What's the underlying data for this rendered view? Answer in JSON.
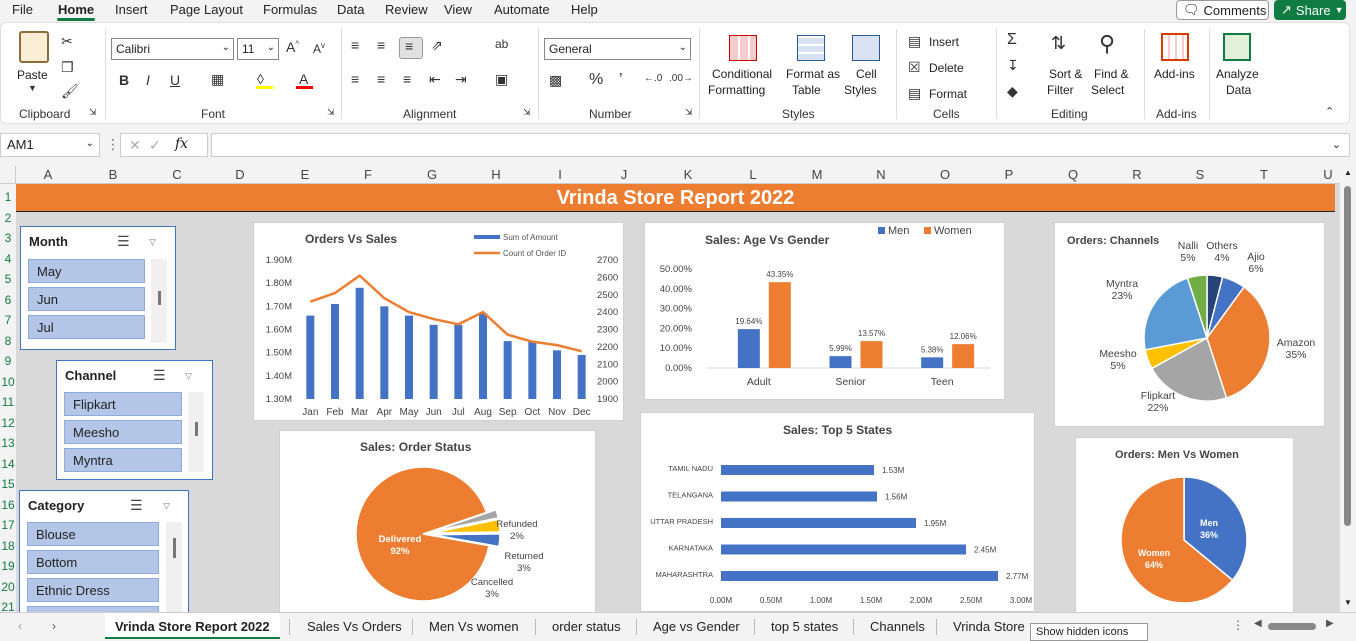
{
  "menu": {
    "items": [
      "File",
      "Home",
      "Insert",
      "Page Layout",
      "Formulas",
      "Data",
      "Review",
      "View",
      "Automate",
      "Help"
    ],
    "comments_label": "Comments",
    "share_label": "Share"
  },
  "ribbon": {
    "clipboard": {
      "label": "Clipboard",
      "paste": "Paste"
    },
    "font": {
      "label": "Font",
      "family": "Calibri",
      "size": "11"
    },
    "alignment": {
      "label": "Alignment"
    },
    "number": {
      "label": "Number",
      "format": "General"
    },
    "styles": {
      "label": "Styles",
      "conditional_1": "Conditional",
      "conditional_2": "Formatting",
      "format_table_1": "Format as",
      "format_table_2": "Table",
      "cell_styles_1": "Cell",
      "cell_styles_2": "Styles"
    },
    "cells": {
      "label": "Cells",
      "insert": "Insert",
      "delete": "Delete",
      "format": "Format"
    },
    "editing": {
      "label": "Editing",
      "sort_1": "Sort &",
      "sort_2": "Filter",
      "find_1": "Find &",
      "find_2": "Select"
    },
    "addins": {
      "label": "Add-ins",
      "btn": "Add-ins"
    },
    "analyze": {
      "btn_1": "Analyze",
      "btn_2": "Data"
    }
  },
  "formula_bar": {
    "name_box": "AM1",
    "fx": "fx",
    "formula": ""
  },
  "columns": [
    "A",
    "B",
    "C",
    "D",
    "E",
    "F",
    "G",
    "H",
    "I",
    "J",
    "K",
    "L",
    "M",
    "N",
    "O",
    "P",
    "Q",
    "R",
    "S",
    "T",
    "U"
  ],
  "rows": [
    "1",
    "2",
    "3",
    "4",
    "5",
    "6",
    "7",
    "8",
    "9",
    "10",
    "11",
    "12",
    "13",
    "14",
    "15",
    "16",
    "17",
    "18",
    "19",
    "20",
    "21"
  ],
  "dashboard": {
    "title": "Vrinda Store Report 2022",
    "slicers": {
      "month": {
        "title": "Month",
        "items": [
          "May",
          "Jun",
          "Jul"
        ]
      },
      "channel": {
        "title": "Channel",
        "items": [
          "Flipkart",
          "Meesho",
          "Myntra"
        ]
      },
      "category": {
        "title": "Category",
        "items": [
          "Blouse",
          "Bottom",
          "Ethnic Dress"
        ]
      }
    }
  },
  "chart_data": [
    {
      "id": "orders_vs_sales",
      "type": "bar",
      "title": "Orders Vs Sales",
      "categories": [
        "Jan",
        "Feb",
        "Mar",
        "Apr",
        "May",
        "Jun",
        "Jul",
        "Aug",
        "Sep",
        "Oct",
        "Nov",
        "Dec"
      ],
      "series": [
        {
          "name": "Sum of Amount",
          "type": "bar",
          "axis": "left",
          "values": [
            1.66,
            1.71,
            1.78,
            1.7,
            1.66,
            1.62,
            1.62,
            1.67,
            1.55,
            1.55,
            1.51,
            1.49
          ]
        },
        {
          "name": "Count of Order ID",
          "type": "line",
          "axis": "right",
          "values": [
            2460,
            2510,
            2610,
            2480,
            2400,
            2360,
            2330,
            2400,
            2270,
            2230,
            2210,
            2175
          ]
        }
      ],
      "y_left_ticks": [
        "1.90M",
        "1.80M",
        "1.70M",
        "1.60M",
        "1.50M",
        "1.40M",
        "1.30M"
      ],
      "y_left_range": [
        1.3,
        1.9
      ],
      "y_right_ticks": [
        "2700",
        "2600",
        "2500",
        "2400",
        "2300",
        "2200",
        "2100",
        "2000",
        "1900"
      ],
      "y_right_range": [
        1900,
        2700
      ],
      "colors": {
        "bar": "#4472c4",
        "line": "#ed7d31"
      }
    },
    {
      "id": "age_vs_gender",
      "type": "bar",
      "title": "Sales: Age Vs Gender",
      "categories": [
        "Adult",
        "Senior",
        "Teen"
      ],
      "series": [
        {
          "name": "Men",
          "values": [
            19.64,
            5.99,
            5.38
          ],
          "labels": [
            "19.64%",
            "5.99%",
            "5.38%"
          ]
        },
        {
          "name": "Women",
          "values": [
            43.35,
            13.57,
            12.06
          ],
          "labels": [
            "43.35%",
            "13.57%",
            "12.06%"
          ]
        }
      ],
      "y_ticks": [
        "50.00%",
        "40.00%",
        "30.00%",
        "20.00%",
        "10.00%",
        "0.00%"
      ],
      "y_range": [
        0,
        50
      ],
      "colors": {
        "Men": "#4472c4",
        "Women": "#ed7d31"
      }
    },
    {
      "id": "orders_channels",
      "type": "pie",
      "title": "Orders: Channels",
      "slices": [
        {
          "name": "Others",
          "value": 4,
          "label": "Others\n4%",
          "color": "#264478"
        },
        {
          "name": "Ajio",
          "value": 6,
          "label": "Ajio\n6%",
          "color": "#4472c4"
        },
        {
          "name": "Amazon",
          "value": 35,
          "label": "Amazon\n35%",
          "color": "#ed7d31"
        },
        {
          "name": "Flipkart",
          "value": 22,
          "label": "Flipkart\n22%",
          "color": "#a5a5a5"
        },
        {
          "name": "Meesho",
          "value": 5,
          "label": "Meesho\n5%",
          "color": "#ffc000"
        },
        {
          "name": "Myntra",
          "value": 23,
          "label": "Myntra\n23%",
          "color": "#5b9bd5"
        },
        {
          "name": "Nalli",
          "value": 5,
          "label": "Nalli\n5%",
          "color": "#70ad47"
        }
      ]
    },
    {
      "id": "order_status",
      "type": "pie",
      "title": "Sales: Order Status",
      "slices": [
        {
          "name": "Delivered",
          "value": 92,
          "label": "Delivered\n92%",
          "color": "#ed7d31"
        },
        {
          "name": "Refunded",
          "value": 2,
          "label": "Refunded\n2%",
          "color": "#a5a5a5"
        },
        {
          "name": "Returned",
          "value": 3,
          "label": "Returned\n3%",
          "color": "#ffc000"
        },
        {
          "name": "Cancelled",
          "value": 3,
          "label": "Cancelled\n3%",
          "color": "#4472c4"
        }
      ]
    },
    {
      "id": "top_5_states",
      "type": "bar",
      "orientation": "horizontal",
      "title": "Sales: Top 5 States",
      "categories": [
        "TAMIL NADU",
        "TELANGANA",
        "UTTAR PRADESH",
        "KARNATAKA",
        "MAHARASHTRA"
      ],
      "values": [
        1.53,
        1.56,
        1.95,
        2.45,
        2.77
      ],
      "labels": [
        "1.53M",
        "1.56M",
        "1.95M",
        "2.45M",
        "2.77M"
      ],
      "x_ticks": [
        "0.00M",
        "0.50M",
        "1.00M",
        "1.50M",
        "2.00M",
        "2.50M",
        "3.00M"
      ],
      "x_range": [
        0,
        3
      ],
      "color": "#4472c4"
    },
    {
      "id": "men_vs_women",
      "type": "pie",
      "title": "Orders: Men Vs Women",
      "slices": [
        {
          "name": "Men",
          "value": 36,
          "label": "Men\n36%",
          "color": "#4472c4"
        },
        {
          "name": "Women",
          "value": 64,
          "label": "Women\n64%",
          "color": "#ed7d31"
        }
      ]
    }
  ],
  "tabs": {
    "items": [
      "Vrinda Store Report  2022",
      "Sales Vs Orders",
      "Men Vs women",
      "order status",
      "Age vs Gender",
      "top 5 states",
      "Channels",
      "Vrinda Store"
    ],
    "active": 0,
    "tooltip": "Show hidden icons"
  }
}
